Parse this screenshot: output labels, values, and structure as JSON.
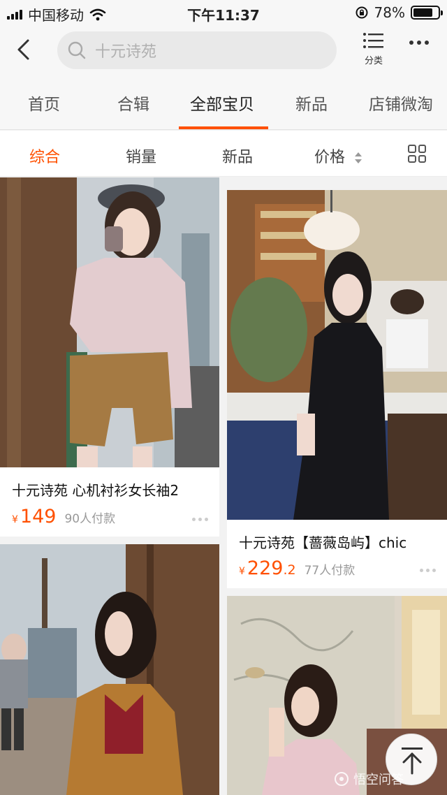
{
  "status_bar": {
    "carrier": "中国移动",
    "time": "下午11:37",
    "battery": "78%",
    "battery_level": 0.78
  },
  "nav": {
    "search_placeholder": "十元诗苑",
    "category_label": "分类"
  },
  "shop_tabs": [
    "首页",
    "合辑",
    "全部宝贝",
    "新品",
    "店铺微淘"
  ],
  "active_shop_tab": "全部宝贝",
  "sort_options": [
    "综合",
    "销量",
    "新品",
    "价格"
  ],
  "active_sort": "综合",
  "products": [
    {
      "title": "十元诗苑 心机衬衫女长袖2",
      "currency": "¥",
      "price_int": "149",
      "price_dec": "",
      "sold": "90人付款"
    },
    {
      "title": "十元诗苑【蔷薇岛屿】chic",
      "currency": "¥",
      "price_int": "229",
      "price_dec": ".2",
      "sold": "77人付款"
    }
  ],
  "watermark": "悟空问答",
  "colors": {
    "accent": "#ff5000",
    "background": "#f2f2f2"
  }
}
